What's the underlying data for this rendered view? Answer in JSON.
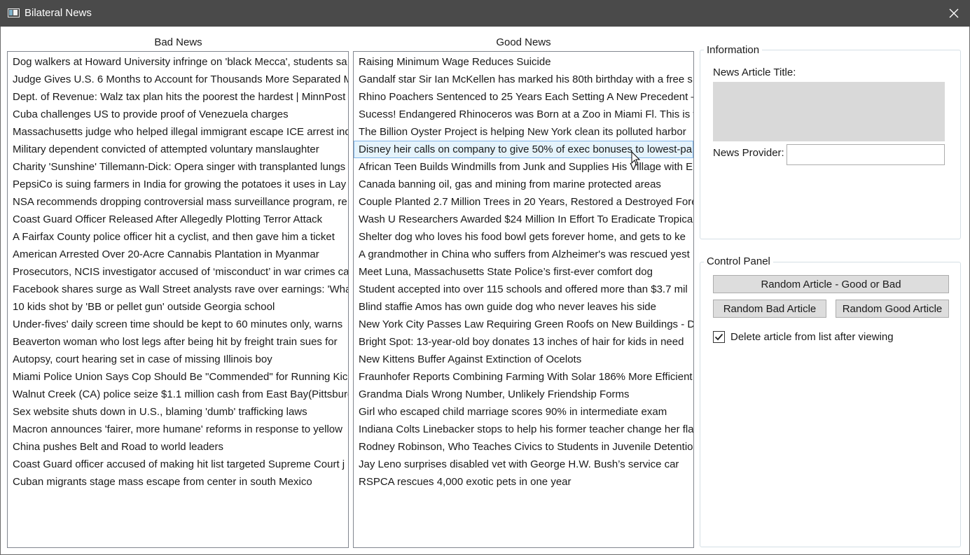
{
  "window": {
    "title": "Bilateral News"
  },
  "bad_news": {
    "header": "Bad News",
    "items": [
      "Dog walkers at Howard University infringe on 'black Mecca', students sa",
      "Judge Gives U.S. 6 Months to Account for Thousands More Separated M",
      "Dept. of Revenue: Walz tax plan hits the poorest the hardest | MinnPost",
      "Cuba challenges US to provide proof of Venezuela charges",
      "Massachusetts judge who helped illegal immigrant escape ICE arrest ind",
      "Military dependent convicted of attempted voluntary manslaughter",
      "Charity 'Sunshine' Tillemann-Dick: Opera singer with transplanted lungs",
      "PepsiCo is suing farmers in India for growing the potatoes it uses in Lay",
      "NSA recommends dropping controversial mass surveillance program, re",
      "Coast Guard Officer Released After Allegedly Plotting Terror Attack",
      "A Fairfax County police officer hit a cyclist, and then gave him a ticket",
      "American Arrested Over 20-Acre Cannabis Plantation in Myanmar",
      "Prosecutors, NCIS investigator accused of ‘misconduct’ in war crimes ca",
      "Facebook shares surge as Wall Street analysts rave over earnings: 'What",
      "10 kids shot by 'BB or pellet gun' outside Georgia school",
      "Under-fives' daily screen time should be kept to 60 minutes only, warns",
      "Beaverton woman who lost legs after being hit by freight train sues for",
      "Autopsy, court hearing set in case of missing Illinois boy",
      "Miami Police Union Says Cop Should Be \"Commended\" for Running Kic",
      "Walnut Creek (CA) police seize $1.1 million cash from East Bay(Pittsburg",
      "Sex website shuts down in U.S., blaming 'dumb' trafficking laws",
      "Macron announces 'fairer, more humane' reforms in response to yellow",
      "China pushes Belt and Road to world leaders",
      "Coast Guard officer accused of making hit list targeted Supreme Court j",
      "Cuban migrants stage mass escape from center in south Mexico"
    ]
  },
  "good_news": {
    "header": "Good News",
    "selected_index": 5,
    "items": [
      "Raising Minimum Wage Reduces Suicide",
      "Gandalf star Sir Ian McKellen has marked his 80th birthday with a free s",
      "Rhino Poachers Sentenced to 25 Years Each Setting A New Precedent –",
      "Sucess! Endangered Rhinoceros was Born at a Zoo in Miami Fl. This is th",
      "The Billion Oyster Project is helping New York clean its polluted harbor",
      "Disney heir calls on company to give 50% of exec bonuses to lowest-pa",
      "African Teen Builds Windmills from Junk and Supplies His Village with E",
      "Canada banning oil, gas and mining from marine protected areas",
      "Couple Planted 2.7 Million Trees in 20 Years, Restored a Destroyed Fore",
      "Wash U Researchers Awarded $24 Million In Effort To Eradicate Tropical",
      "Shelter dog who loves his food bowl gets forever home, and gets to ke",
      "A grandmother in China who suffers from Alzheimer's was rescued yest",
      "Meet Luna, Massachusetts State Police’s first-ever comfort dog",
      "Student accepted into over 115 schools and offered more than $3.7 mil",
      "Blind staffie Amos has own guide dog who never leaves his side",
      "New York City Passes Law Requiring Green Roofs on New Buildings - Dv",
      "Bright Spot: 13-year-old boy donates 13 inches of hair for kids in need",
      "New Kittens Buffer Against Extinction of Ocelots",
      "Fraunhofer Reports Combining Farming With Solar 186% More Efficient",
      "Grandma Dials Wrong Number, Unlikely Friendship Forms",
      "Girl who escaped child marriage scores 90% in intermediate exam",
      "Indiana Colts Linebacker stops to help his former teacher change her fla",
      "Rodney Robinson, Who Teaches Civics to Students in Juvenile Detention",
      "Jay Leno surprises disabled vet with George H.W. Bush’s service car",
      "RSPCA rescues 4,000 exotic pets in one year"
    ]
  },
  "information": {
    "legend": "Information",
    "article_title_label": "News Article Title:",
    "article_title_value": "",
    "provider_label": "News Provider:",
    "provider_value": ""
  },
  "control_panel": {
    "legend": "Control Panel",
    "random_any_label": "Random Article - Good or Bad",
    "random_bad_label": "Random Bad Article",
    "random_good_label": "Random Good Article",
    "delete_checkbox_label": "Delete article from list after viewing",
    "delete_checked": true
  }
}
